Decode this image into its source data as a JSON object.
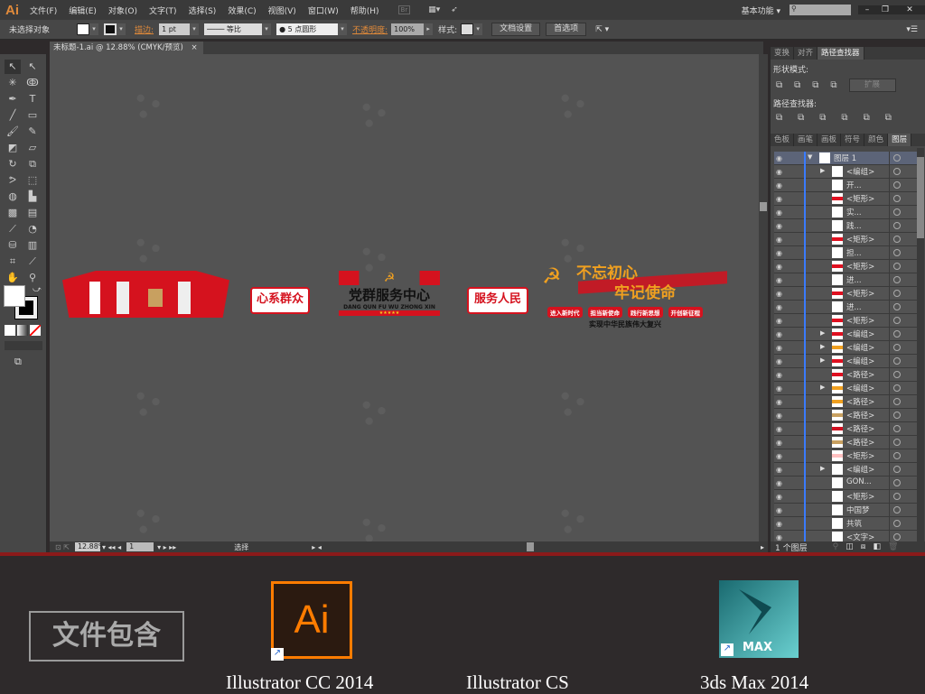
{
  "app": {
    "logo": "Ai",
    "menus": [
      "文件(F)",
      "编辑(E)",
      "对象(O)",
      "文字(T)",
      "选择(S)",
      "效果(C)",
      "视图(V)",
      "窗口(W)",
      "帮助(H)"
    ],
    "bridge": "Br",
    "workspace": "基本功能",
    "search_placeholder": ""
  },
  "control": {
    "selection": "未选择对象",
    "stroke_label": "描边:",
    "stroke_value": "1 pt",
    "stroke_profile": "等比",
    "brush": "5 点圆形",
    "opacity_label": "不透明度:",
    "opacity_value": "100%",
    "style_label": "样式:",
    "doc_setup": "文档设置",
    "preferences": "首选项"
  },
  "document": {
    "tab": "未标题-1.ai @ 12.88% (CMYK/预览)",
    "close": "×"
  },
  "status": {
    "zoom": "12.88%",
    "page": "1",
    "tool": "选择"
  },
  "panel": {
    "tabs_top": [
      "变换",
      "对齐",
      "路径查找器"
    ],
    "shape_modes": "形状模式:",
    "expand": "扩展",
    "pathfinders": "路径查找器:",
    "tabs_bottom": [
      "色板",
      "画笔",
      "画板",
      "符号",
      "颜色",
      "图层"
    ],
    "footer": "1 个图层",
    "layers": [
      {
        "name": "图层 1",
        "thumb": "#ffffff",
        "expand": "down"
      },
      {
        "name": "<编组>",
        "thumb": "#ffffff",
        "expand": "right"
      },
      {
        "name": "开...",
        "thumb": "#ffffff"
      },
      {
        "name": "<矩形>",
        "thumb": "#e01020"
      },
      {
        "name": "实...",
        "thumb": "#ffffff"
      },
      {
        "name": "践...",
        "thumb": "#ffffff"
      },
      {
        "name": "<矩形>",
        "thumb": "#e01020"
      },
      {
        "name": "担...",
        "thumb": "#ffffff"
      },
      {
        "name": "<矩形>",
        "thumb": "#e01020"
      },
      {
        "name": "进...",
        "thumb": "#ffffff"
      },
      {
        "name": "<矩形>",
        "thumb": "#e01020"
      },
      {
        "name": "进...",
        "thumb": "#ffffff"
      },
      {
        "name": "<矩形>",
        "thumb": "#e01020"
      },
      {
        "name": "<编组>",
        "thumb": "#e01020",
        "expand": "right"
      },
      {
        "name": "<编组>",
        "thumb": "#f0a020",
        "expand": "right"
      },
      {
        "name": "<编组>",
        "thumb": "#e01020",
        "expand": "right"
      },
      {
        "name": "<路径>",
        "thumb": "#e01020"
      },
      {
        "name": "<编组>",
        "thumb": "#f0a020",
        "expand": "right"
      },
      {
        "name": "<路径>",
        "thumb": "#f0a020"
      },
      {
        "name": "<路径>",
        "thumb": "#c8a060"
      },
      {
        "name": "<路径>",
        "thumb": "#d01020"
      },
      {
        "name": "<路径>",
        "thumb": "#c8a060"
      },
      {
        "name": "<矩形>",
        "thumb": "#ffc0c0"
      },
      {
        "name": "<编组>",
        "thumb": "#ffffff",
        "expand": "right"
      },
      {
        "name": "GON...",
        "thumb": "#ffffff"
      },
      {
        "name": "<矩形>",
        "thumb": "#ffffff"
      },
      {
        "name": "中国梦",
        "thumb": "#ffffff"
      },
      {
        "name": "共筑",
        "thumb": "#ffffff"
      },
      {
        "name": "<文字>",
        "thumb": "#ffffff"
      }
    ]
  },
  "artwork": {
    "b1": "心系群众",
    "b2": "党群服务中心",
    "b2_pinyin": "DANG QUN FU WU ZHONG XIN",
    "b3": "服务人民",
    "b4a": "不忘初心",
    "b4b": "牢记使命",
    "b4_tags": [
      "进入新时代",
      "担当新使命",
      "践行新思想",
      "开创新征程"
    ],
    "b4_slogan": "实现中华民族伟大复兴"
  },
  "bottom": {
    "label": "文件包含",
    "apps": [
      {
        "name": "Illustrator CC 2014",
        "icon": "Ai"
      },
      {
        "name": "Illustrator CS"
      },
      {
        "name": "3ds Max 2014",
        "icon": "MAX"
      }
    ]
  },
  "colors": {
    "accent": "#e08a3a",
    "red": "#d5121e",
    "ai_orange": "#ff7c00"
  }
}
